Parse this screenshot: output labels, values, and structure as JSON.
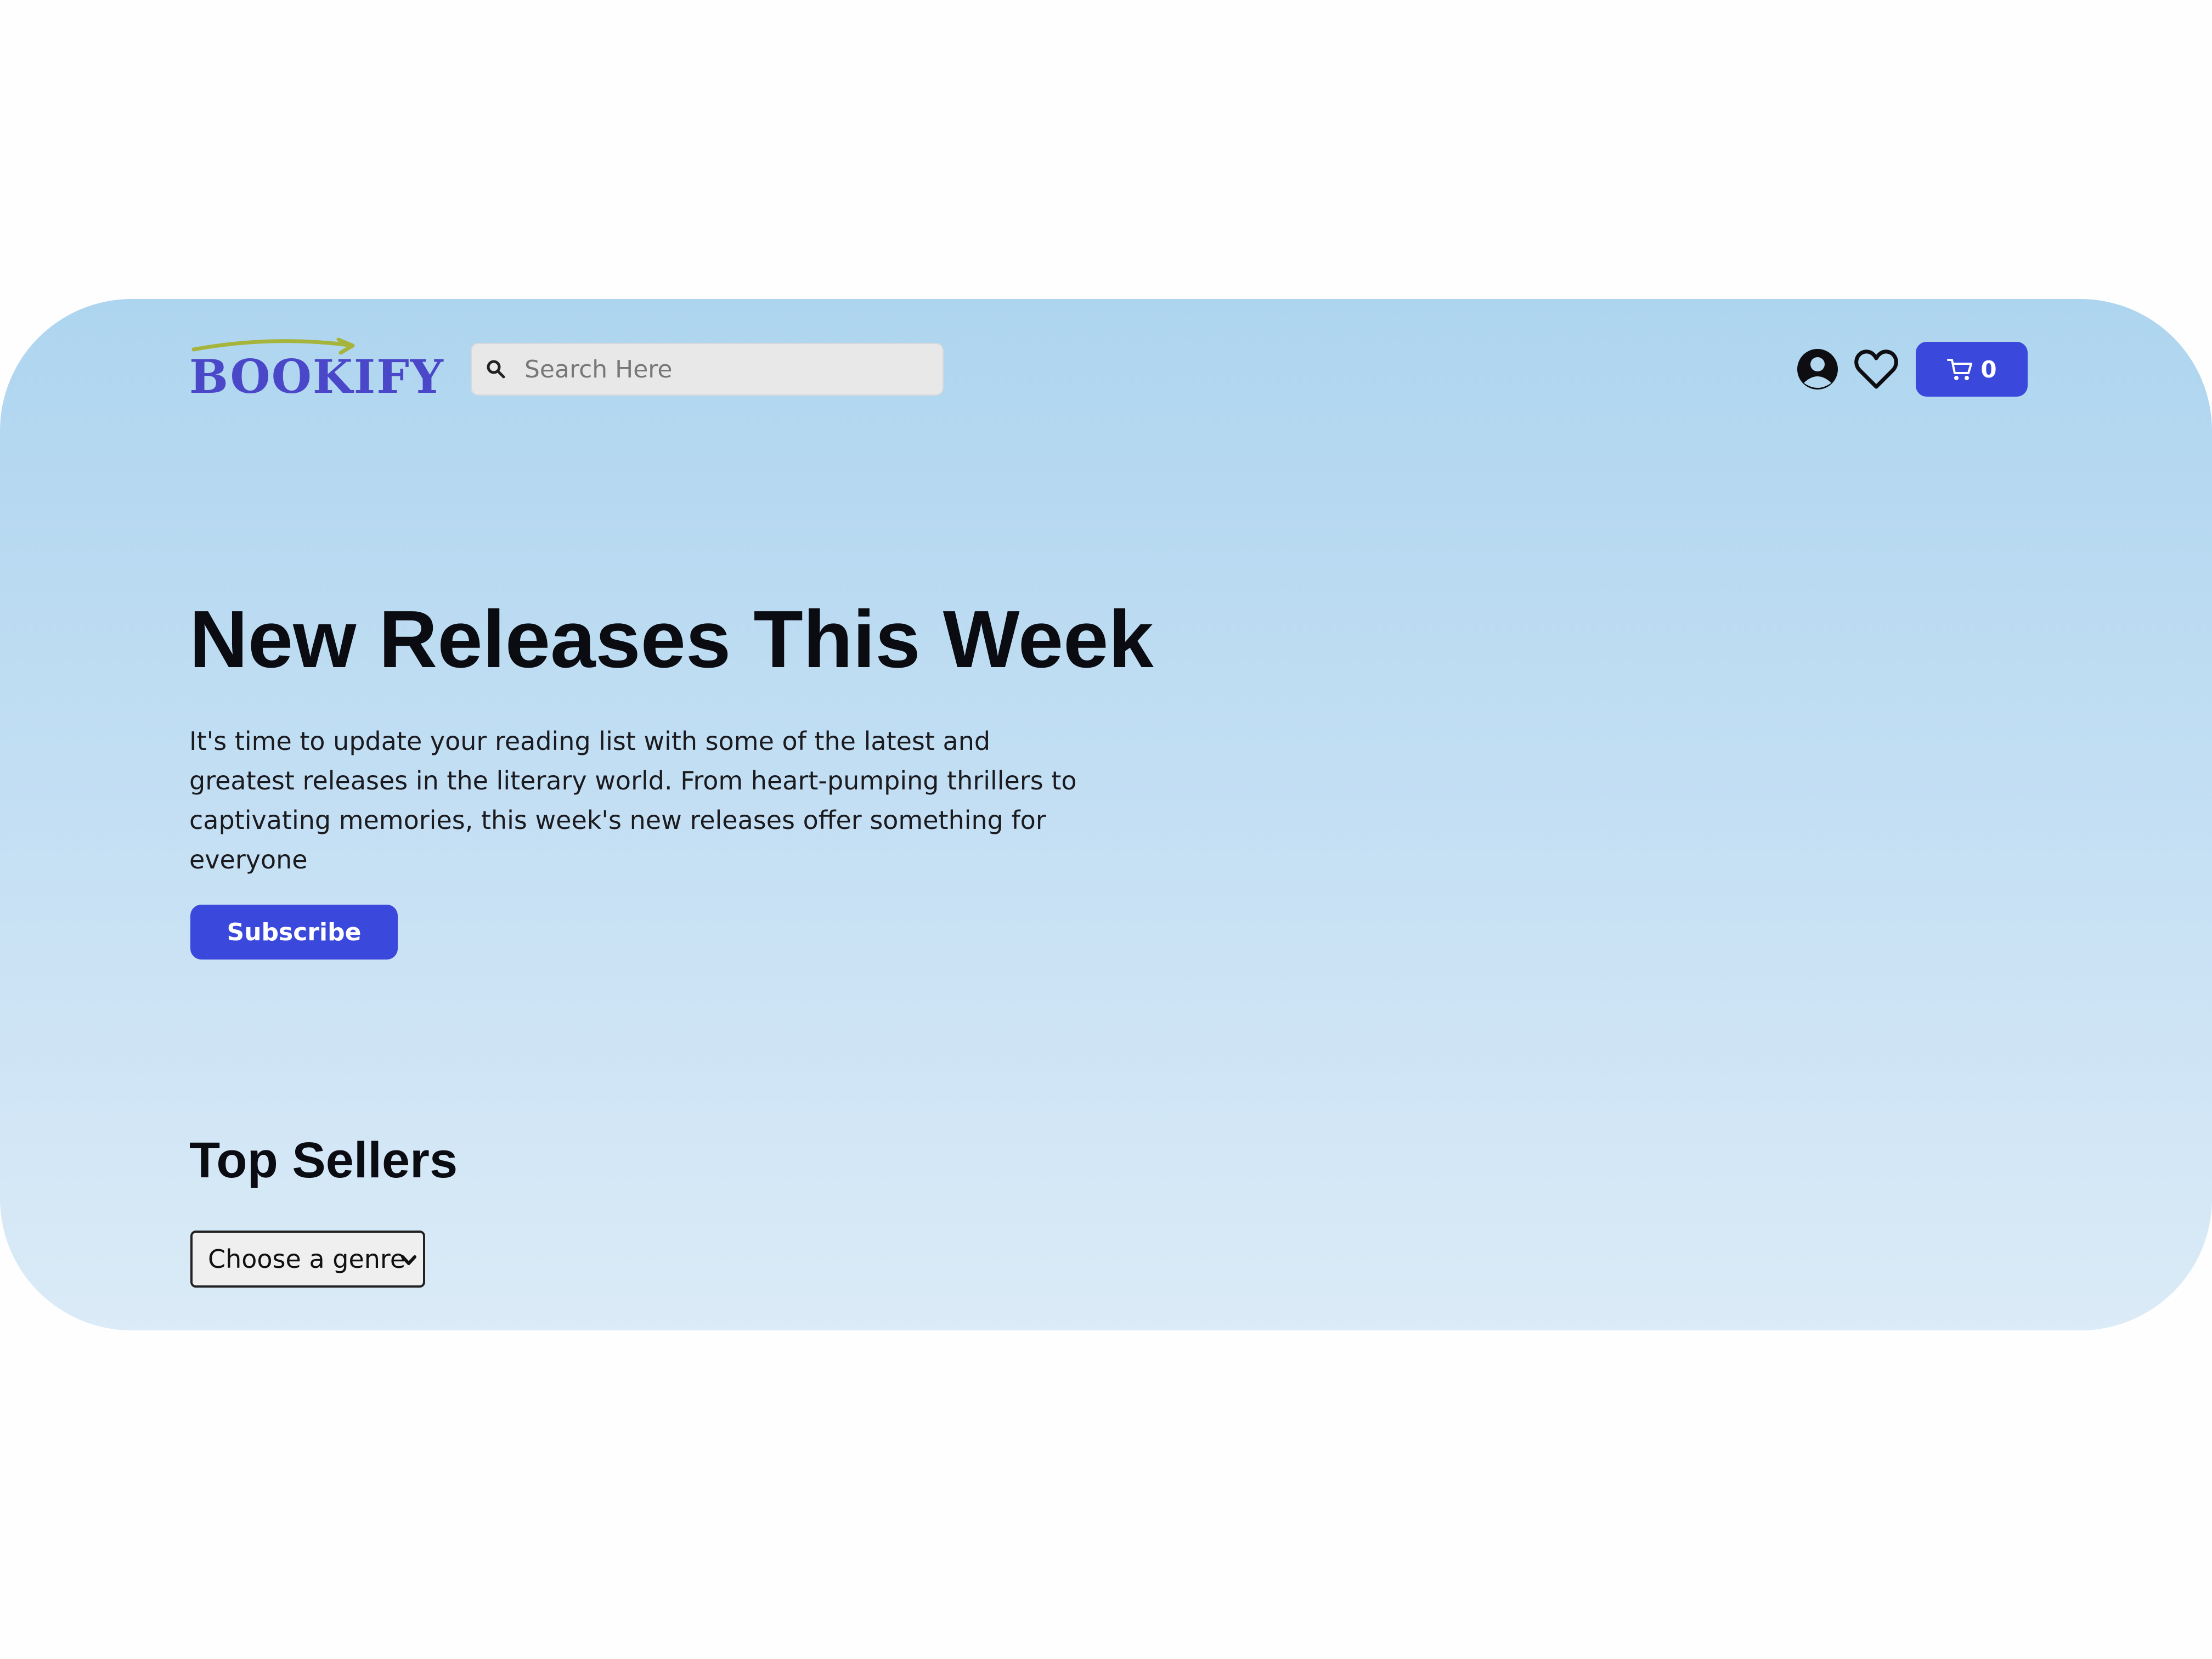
{
  "brand": {
    "name": "BOOKIFY",
    "accent_color": "#3b48dc",
    "logo_arrow_color": "#a6b43c"
  },
  "header": {
    "search": {
      "placeholder": "Search Here",
      "value": "",
      "icon": "search-icon"
    },
    "icons": [
      "account-icon",
      "heart-icon",
      "cart-icon"
    ],
    "cart_count": "0"
  },
  "hero": {
    "title": "New Releases This Week",
    "description": "It's time to update your reading list with some of the latest and greatest releases in the literary world. From heart-pumping thrillers to captivating memories, this week's new releases offer something for everyone",
    "subscribe_label": "Subscribe"
  },
  "top_sellers": {
    "title": "Top Sellers",
    "genre_select": {
      "selected": "Choose a genre"
    }
  }
}
